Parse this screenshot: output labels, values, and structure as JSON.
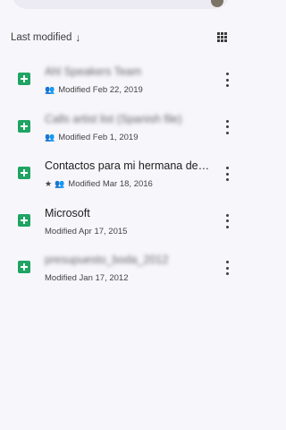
{
  "sort": {
    "label": "Last modified",
    "arrow": "↓"
  },
  "icons": {
    "people": "people-icon",
    "star": "star-icon",
    "sheet": "google-sheets-icon"
  },
  "files": [
    {
      "title": "Ahl Speakers Team",
      "blurred": true,
      "shared": true,
      "starred": false,
      "modified": "Modified Feb 22, 2019"
    },
    {
      "title": "Calls artist list (Spanish file)",
      "blurred": true,
      "shared": true,
      "starred": false,
      "modified": "Modified Feb 1, 2019"
    },
    {
      "title": "Contactos para mi hermana de Telcel on ...",
      "blurred": false,
      "shared": true,
      "starred": true,
      "modified": "Modified Mar 18, 2016"
    },
    {
      "title": "Microsoft",
      "blurred": false,
      "shared": false,
      "starred": false,
      "modified": "Modified Apr 17, 2015"
    },
    {
      "title": "presupuesto_boda_2012",
      "blurred": true,
      "shared": false,
      "starred": false,
      "modified": "Modified Jan 17, 2012"
    }
  ]
}
